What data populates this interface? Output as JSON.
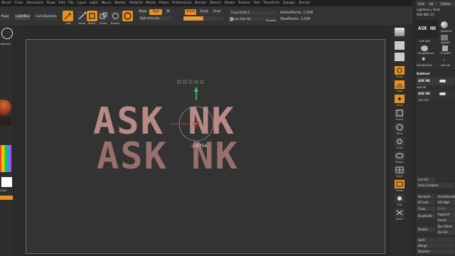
{
  "menu": [
    "Brush",
    "Color",
    "Document",
    "Draw",
    "Edit",
    "File",
    "Layer",
    "Light",
    "Macro",
    "Marker",
    "Material",
    "Movie",
    "Picker",
    "Preferences",
    "Render",
    "Stencil",
    "Stroke",
    "Texture",
    "Tool",
    "Transform",
    "Zplugin",
    "Zscript"
  ],
  "tabs": {
    "page": "Page",
    "lightbox": "LightBox",
    "live_boolean": "Live Boolean"
  },
  "toolbar": {
    "edit": "Edit",
    "draw": "Draw",
    "move": "Move",
    "scale": "Scale",
    "rotate": "Rotate",
    "rgb_intensity": "Rgb Intensity",
    "z_intensity": "Z Intensity",
    "focal_shift": "Focal Shift 0",
    "draw_size": "Draw Size 64",
    "dynamic": "Dynamic",
    "active_points": "ActivePoints: 1,028",
    "total_points": "TotalPoints: 2,056",
    "zadd": "Zadd",
    "zsub": "Zsub",
    "zcut": "Zcut",
    "mrgb": "Mrgb",
    "rgb": "Rgb",
    "m": "M"
  },
  "left": {
    "lightbox_text": "Lightbox",
    "color_label": "Color"
  },
  "viewport": {
    "front_text": "ASK NK",
    "back_text": "ASK NK",
    "gizmo_value": "-2.0754"
  },
  "right_tools": [
    "Persp",
    "Floor",
    "Local",
    "Frame",
    "Move",
    "Scale",
    "Rotate",
    "PolyF",
    "Transp",
    "Solo",
    "Xpose"
  ],
  "panel": {
    "goz": "GoZ",
    "all": "All",
    "visible": "Visible",
    "lightbox_tools": "Lightbox ▸ Tools",
    "tool_name": "ASK NK1  41",
    "ask_nk": "ASK NK",
    "ask_nk1": "ASK NK1",
    "sphere": "SphereB",
    "alpha": "AlphaB",
    "simple_brush": "SimpleBrush",
    "eraser": "EraserB",
    "polymesh": "PolyMesh3D",
    "ask_nk_small": "ASK NK",
    "num": "2",
    "subtool": "Subtool",
    "st1": "ASK NK",
    "st2": "ASK NK1",
    "list_all": "List All",
    "auto_collapse": "Auto Collapse",
    "rename": "Rename",
    "autoreorder": "AutoReorder",
    "all_low": "All Low",
    "all_high": "All High",
    "copy": "Copy",
    "paste": "Paste",
    "duplicate": "Duplicate",
    "append": "Append",
    "insert": "Insert",
    "delete": "Delete",
    "del_other": "Del Other",
    "del_all": "Del All",
    "split": "Split",
    "merge": "Merge",
    "boolean": "Boolean"
  },
  "colors": {
    "accent": "#e8901e",
    "text": "#c4928c"
  }
}
